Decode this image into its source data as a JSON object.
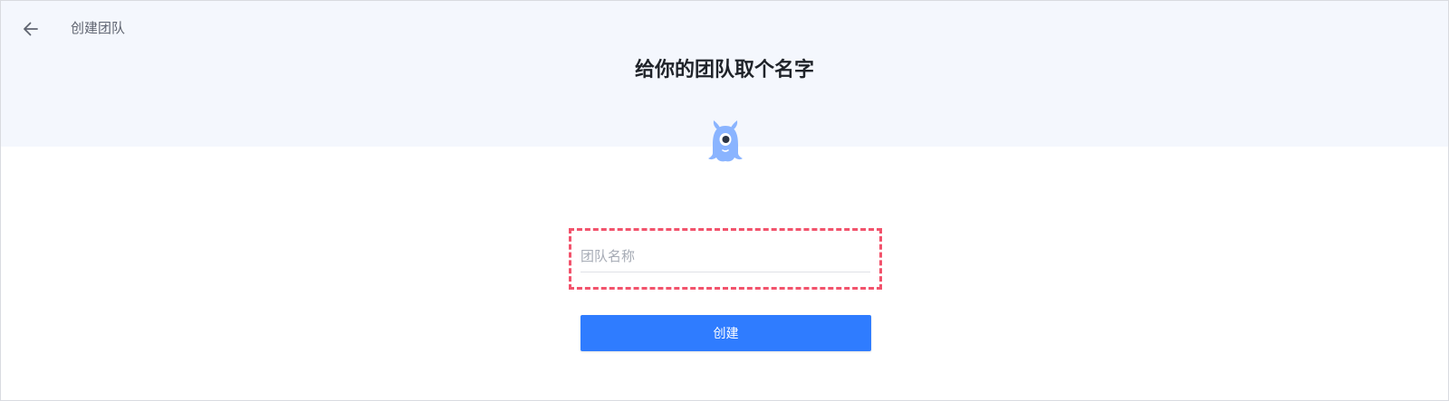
{
  "header": {
    "back_icon": "arrow-left-icon",
    "title": "创建团队"
  },
  "hero": {
    "heading": "给你的团队取个名字",
    "mascot_icon": "one-eyed-monster-icon"
  },
  "form": {
    "team_name": {
      "value": "",
      "placeholder": "团队名称"
    },
    "submit_label": "创建"
  },
  "colors": {
    "hero_background": "#f4f7fd",
    "primary": "#2f7cff",
    "mascot": "#8ab4ff",
    "focus_outline": "#f2536c"
  }
}
